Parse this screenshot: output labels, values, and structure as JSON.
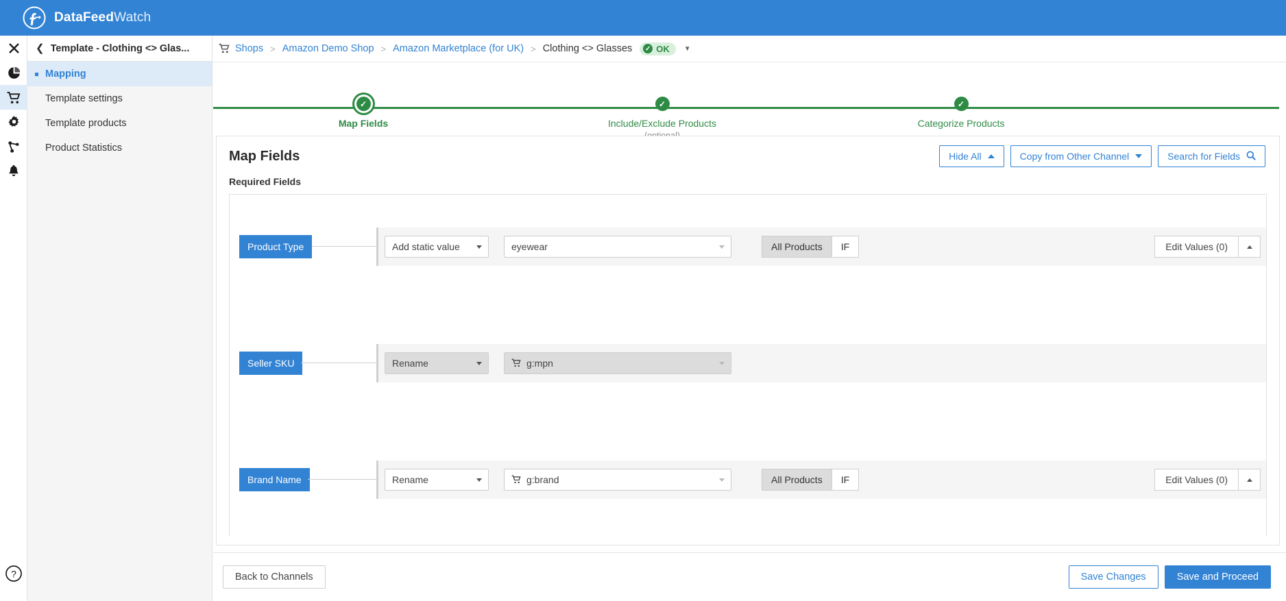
{
  "brand": {
    "name_bold": "DataFeed",
    "name_light": "Watch",
    "logo_icon": "datafeedwatch-logo-icon"
  },
  "rail": {
    "items": [
      {
        "icon": "close-icon",
        "name": "close"
      },
      {
        "icon": "pie-chart-icon",
        "name": "dashboard"
      },
      {
        "icon": "shopping-cart-icon",
        "name": "shops",
        "active": true
      },
      {
        "icon": "gear-icon",
        "name": "settings"
      },
      {
        "icon": "share-branch-icon",
        "name": "integrations"
      },
      {
        "icon": "bell-icon",
        "name": "notifications"
      }
    ],
    "help_icon": "question-mark-circle-icon"
  },
  "left_panel": {
    "back_icon": "chevron-left-icon",
    "title": "Template - Clothing <> Glas...",
    "items": [
      {
        "label": "Mapping",
        "active": true
      },
      {
        "label": "Template settings",
        "active": false
      },
      {
        "label": "Template products",
        "active": false
      },
      {
        "label": "Product Statistics",
        "active": false
      }
    ]
  },
  "breadcrumb": {
    "cart_icon": "shopping-cart-icon",
    "items": [
      "Shops",
      "Amazon Demo Shop",
      "Amazon Marketplace (for UK)",
      "Clothing <> Glasses"
    ],
    "separator": ">",
    "status_badge": {
      "label": "OK",
      "check_icon": "check-circle-icon",
      "color": "#2e8b44",
      "bg": "#d9f0dd"
    },
    "caret_icon": "chevron-down-icon"
  },
  "stepper": {
    "line_color": "#2e8b44",
    "steps": [
      {
        "label": "Map Fields",
        "sub": "",
        "state": "current"
      },
      {
        "label": "Include/Exclude Products",
        "sub": "(optional)",
        "state": "done"
      },
      {
        "label": "Categorize Products",
        "sub": "",
        "state": "done"
      }
    ]
  },
  "card": {
    "title": "Map Fields",
    "actions": [
      {
        "label": "Hide All",
        "icon": "caret-up-icon"
      },
      {
        "label": "Copy from Other Channel",
        "icon": "caret-down-icon"
      },
      {
        "label": "Search for Fields",
        "icon": "search-icon"
      }
    ],
    "section_label": "Required Fields",
    "rows": [
      {
        "field": "Product Type",
        "operation": "Add static value",
        "value": "eyewear",
        "value_icon": "",
        "disabled": false,
        "has_scope": true,
        "scope_all": "All Products",
        "scope_if": "IF",
        "edit_values": "Edit Values (0)",
        "collapse_icon": "caret-up-icon"
      },
      {
        "field": "Seller SKU",
        "operation": "Rename",
        "value": "g:mpn",
        "value_icon": "shopping-cart-icon",
        "disabled": true,
        "has_scope": false,
        "scope_all": "",
        "scope_if": "",
        "edit_values": "",
        "collapse_icon": ""
      },
      {
        "field": "Brand Name",
        "operation": "Rename",
        "value": "g:brand",
        "value_icon": "shopping-cart-icon",
        "disabled": false,
        "has_scope": true,
        "scope_all": "All Products",
        "scope_if": "IF",
        "edit_values": "Edit Values (0)",
        "collapse_icon": "caret-up-icon"
      }
    ]
  },
  "footer": {
    "back": "Back to Channels",
    "save": "Save Changes",
    "proceed": "Save and Proceed"
  },
  "colors": {
    "brand_blue": "#3283d4",
    "green": "#2e8b44",
    "panel_bg": "#f5f5f5"
  }
}
